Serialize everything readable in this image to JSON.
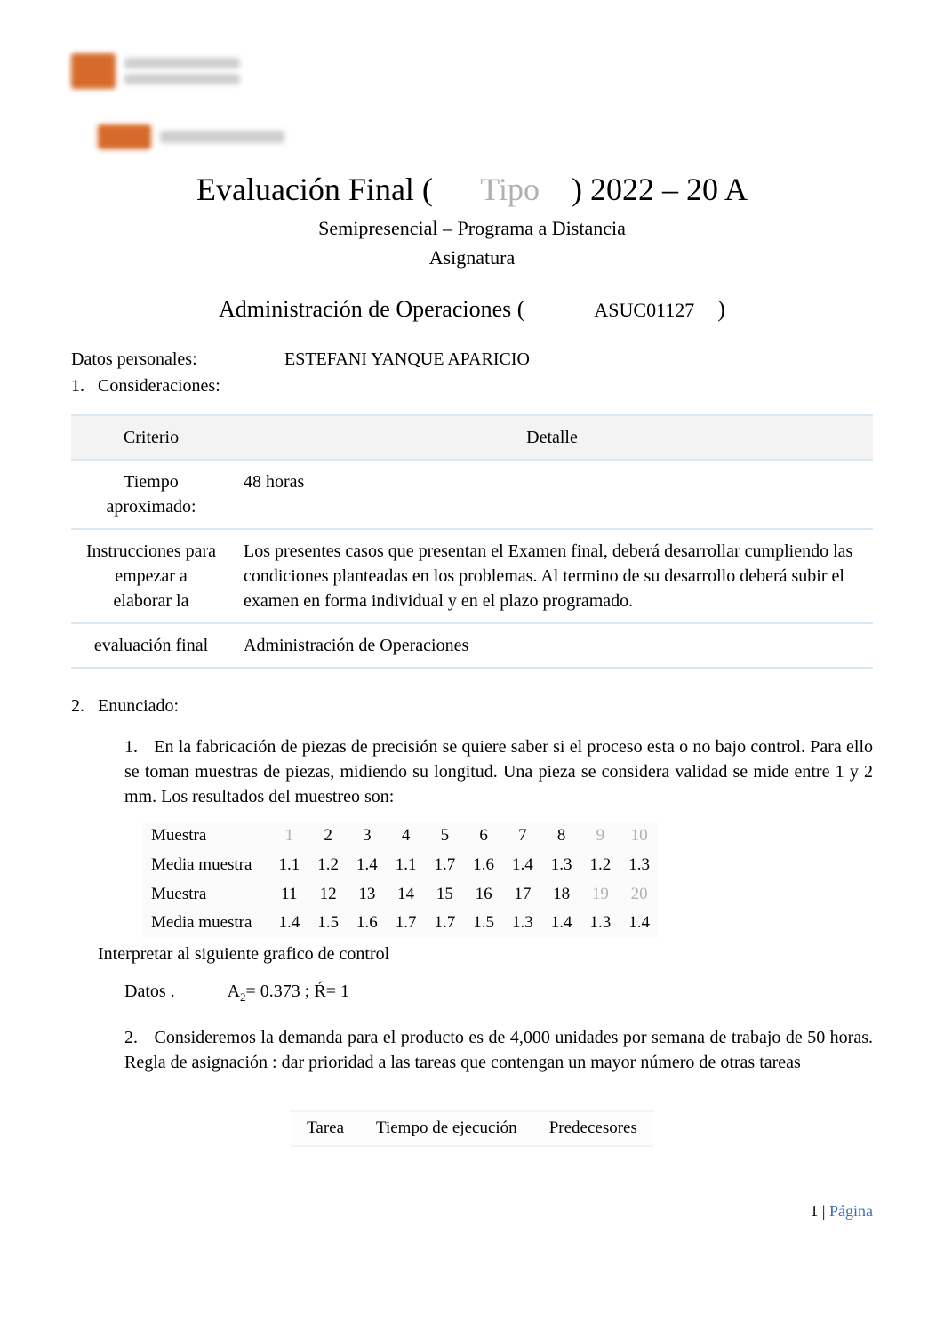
{
  "title": {
    "pref_black": "Evaluación Final (",
    "mid_gray": "Tipo",
    "suf_black": ") 2022 – 20 A"
  },
  "subtitle1": "Semipresencial – Programa a Distancia",
  "subtitle2": "Asignatura",
  "course": {
    "prefix": "Administración de Operaciones (",
    "code": "ASUC01127",
    "suffix": ")"
  },
  "personal_label": "Datos personales:",
  "personal_value": "ESTEFANI YANQUE APARICIO",
  "consider_label": "Consideraciones:",
  "info_header": {
    "c1": "Criterio",
    "c2": "Detalle"
  },
  "info_rows": [
    {
      "criterio": "Tiempo aproximado:",
      "detalle": "48 horas"
    },
    {
      "criterio": "Instrucciones para empezar a elaborar la",
      "detalle": "Los   presentes   casos                 que   presentan   el   Examen   final,   deberá desarrollar           cumpliendo   las               condiciones   planteadas   en   los problemas. Al termino de su desarrollo deberá subir el examen en forma individual y          en el plazo programado."
    },
    {
      "criterio": "evaluación final",
      "detalle": "Administración de Operaciones"
    }
  ],
  "section2_label": "Enunciado:",
  "q1": {
    "num": "1.",
    "text": "En la fabricación de piezas de precisión se quiere saber si el proceso esta o no bajo control. Para ello se toman muestras de piezas, midiendo su longitud. Una pieza se considera validad se mide entre 1 y 2     mm.  Los resultados del muestreo son:"
  },
  "chart_data": {
    "type": "table",
    "rows": [
      {
        "label": "Muestra",
        "values": [
          "1",
          "2",
          "3",
          "4",
          "5",
          "6",
          "7",
          "8",
          "9",
          "10"
        ]
      },
      {
        "label": "Media muestra",
        "values": [
          "1.1",
          "1.2",
          "1.4",
          "1.1",
          "1.7",
          "1.6",
          "1.4",
          "1.3",
          "1.2",
          "1.3"
        ]
      },
      {
        "label": "Muestra",
        "values": [
          "11",
          "12",
          "13",
          "14",
          "15",
          "16",
          "17",
          "18",
          "19",
          "20"
        ]
      },
      {
        "label": "Media muestra",
        "values": [
          "1.4",
          "1.5",
          "1.6",
          "1.7",
          "1.7",
          "1.5",
          "1.3",
          "1.4",
          "1.3",
          "1.4"
        ]
      }
    ],
    "faded_cols_row0": [
      0,
      8,
      9
    ],
    "faded_cols_row2": [
      8,
      9
    ]
  },
  "interpret": "Interpretar al siguiente grafico de control",
  "datos": {
    "label": "Datos .",
    "formula_prefix": "A",
    "formula_sub": "2",
    "formula_mid": "= 0.373 ; Ŕ= 1"
  },
  "q2": {
    "num": "2.",
    "text": "Consideremos la   demanda para el   producto   es de 4,000 unidades por semana de trabajo de 50 horas.   Regla de asignación   : dar prioridad a las tareas que contengan un mayor número de otras tareas"
  },
  "small_table": {
    "c1": "Tarea",
    "c2": "Tiempo de ejecución",
    "c3": "Predecesores"
  },
  "footer": {
    "num": "1",
    "sep": " | ",
    "label": "Página"
  }
}
